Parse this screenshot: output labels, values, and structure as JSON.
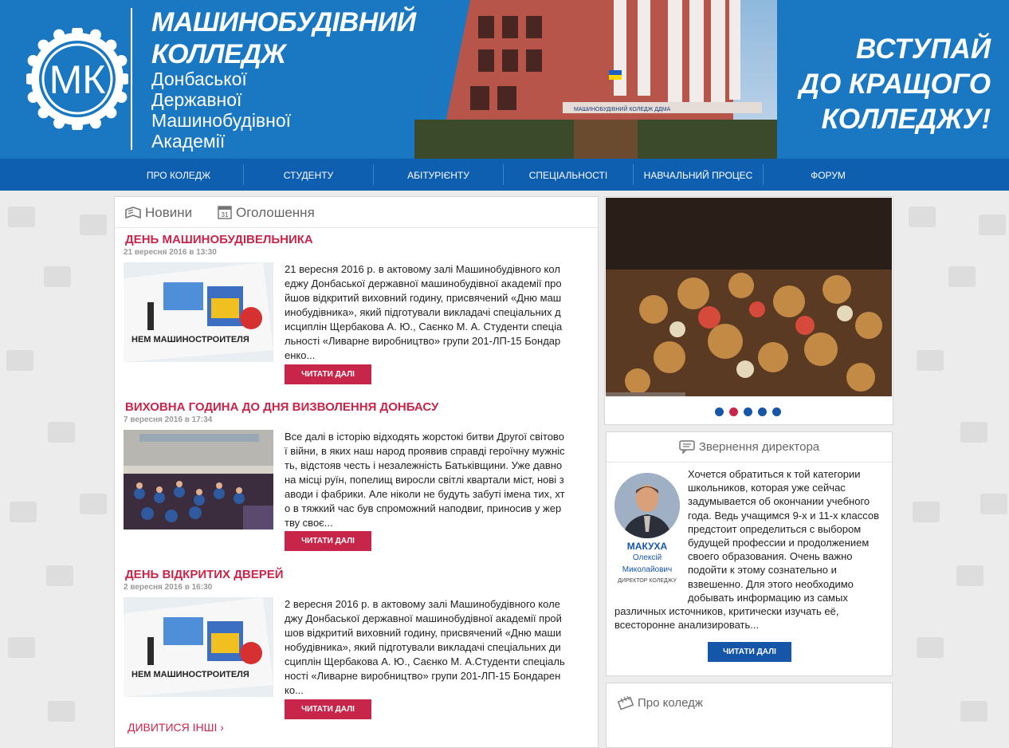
{
  "header": {
    "logo_text": "МК",
    "title_line1": "МАШИНОБУДІВНИЙ",
    "title_line2": "КОЛЛЕДЖ",
    "subtitle_line1": "Донбаської",
    "subtitle_line2": "Державної",
    "subtitle_line3": "Машинобудівної",
    "subtitle_line4": "Академії",
    "building_sign": "МАШИНОБУДІВНИЙ КОЛЕДЖ ДДМА",
    "slogan_line1": "ВСТУПАЙ",
    "slogan_line2": "ДО КРАЩОГО",
    "slogan_line3": "КОЛЛЕДЖУ!"
  },
  "nav": {
    "items": [
      "ПРО КОЛЕДЖ",
      "СТУДЕНТУ",
      "АБІТУРІЄНТУ",
      "СПЕЦІАЛЬНОСТІ",
      "НАВЧАЛЬНИЙ ПРОЦЕС",
      "ФОРУМ"
    ]
  },
  "news": {
    "tab_news": "Новини",
    "tab_announcements": "Оголошення",
    "calendar_day": "31",
    "articles": [
      {
        "title": "ДЕНЬ МАШИНОБУДІВЕЛЬНИКА",
        "date": "21 вересня 2016 в 13:30",
        "text": "21 вересня 2016 р. в актовому залі Машинобудівного коледжу Донбаської державної машинобудівної академії пройшов відкритий виховний годину, присвячений «Дню машинобудівника», який підготували викладачі спеціальних дисциплін Щербакова А. Ю., Саєнко М. А. Студенти спеціальності «Ливарне виробництво» групи 201-ЛП-15 Бондаренко...",
        "button": "ЧИТАТИ ДАЛІ"
      },
      {
        "title": "ВИХОВНА ГОДИНА ДО ДНЯ ВИЗВОЛЕННЯ ДОНБАСУ",
        "date": "7 вересня 2016 в 17:34",
        "text": "Все далі в історію відходять жорстокі битви Другої світової війни, в яких наш народ проявив справді героїчну мужність, відстояв честь і незалежність Батьківщини. Уже давно на місці руїн, попелищ виросли світлі квартали міст, нові заводи і фабрики. Але ніколи не будуть забуті імена тих, хто в тяжкий час був спроможний наподвиг, приносив у жертву своє...",
        "button": "ЧИТАТИ ДАЛІ"
      },
      {
        "title": "ДЕНЬ ВІДКРИТИХ ДВЕРЕЙ",
        "date": "2 вересня 2016 в 16:30",
        "text": "2 вересня 2016 р. в актовому залі Машинобудівного коледжу Донбаської державної машинобудівної академії пройшов відкритий виховний годину, присвячений «Дню машинобудівника», який підготували викладачі спеціальних дисциплін Щербакова А. Ю., Саєнко М. А.Студенти спеціальності «Ливарне виробництво» групи 201-ЛП-15 Бондаренко...",
        "button": "ЧИТАТИ ДАЛІ"
      }
    ],
    "banner_text": "НЕМ МАШИНОСТРОИТЕЛЯ",
    "more_link": "ДИВИТИСЯ ІНШІ"
  },
  "slider": {
    "dots_count": 5,
    "active_dot": 2
  },
  "director": {
    "heading": "Звернення директора",
    "surname": "МАКУХА",
    "first_name": "Олексій",
    "patronymic": "Миколайович",
    "position": "ДИРЕКТОР КОЛЕДЖУ",
    "text": "Хочется обратиться к той категории школьников, которая уже сейчас задумывается об окончании учебного года. Ведь учащимся 9-х и 11-х классов предстоит определиться с выбором будущей профессии и продолжением своего образования. Очень важно подойти к этому сознательно и взвешенно. Для этого необходимо добывать информацию из самых различных источников, критически изучать её, всесторонне анализировать...",
    "button": "ЧИТАТИ ДАЛІ"
  },
  "about": {
    "heading": "Про коледж"
  },
  "colors": {
    "header_blue": "#1a78c2",
    "nav_blue": "#0f5fb0",
    "accent_red": "#c8254a",
    "button_blue": "#1556a8"
  }
}
